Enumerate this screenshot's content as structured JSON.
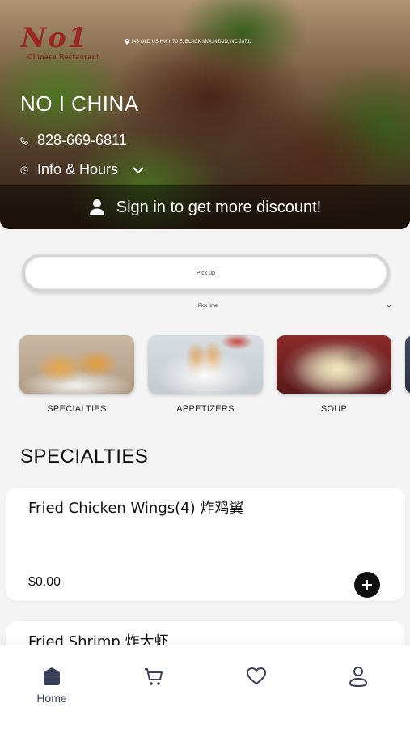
{
  "hero": {
    "logo_script": "No1",
    "logo_sub": "Chinese Restaurant",
    "address": "143 OLD US HWY 70 E, BLACK MOUNTAIN, NC 28711",
    "restaurant_name": "NO I CHINA",
    "phone": "828-669-6811",
    "info_label": "Info & Hours",
    "signin_text": "Sign in to get more discount!"
  },
  "order": {
    "pickup_label": "Pick up",
    "pick_time_label": "Pick time"
  },
  "categories": [
    {
      "label": "SPECIALTIES",
      "image": "fried-shrimp-photo"
    },
    {
      "label": "APPETIZERS",
      "image": "egg-rolls-photo"
    },
    {
      "label": "SOUP",
      "image": "soup-photo"
    },
    {
      "label": "",
      "image": "more-category-photo"
    }
  ],
  "section": {
    "title": "SPECIALTIES",
    "items": [
      {
        "name": "Fried Chicken Wings(4) 炸鸡翼",
        "price": "$0.00"
      },
      {
        "name": "Fried Shrimp 炸大虾",
        "price": ""
      }
    ]
  },
  "nav": {
    "home_label": "Home",
    "active_color": "#3a3f5a"
  }
}
